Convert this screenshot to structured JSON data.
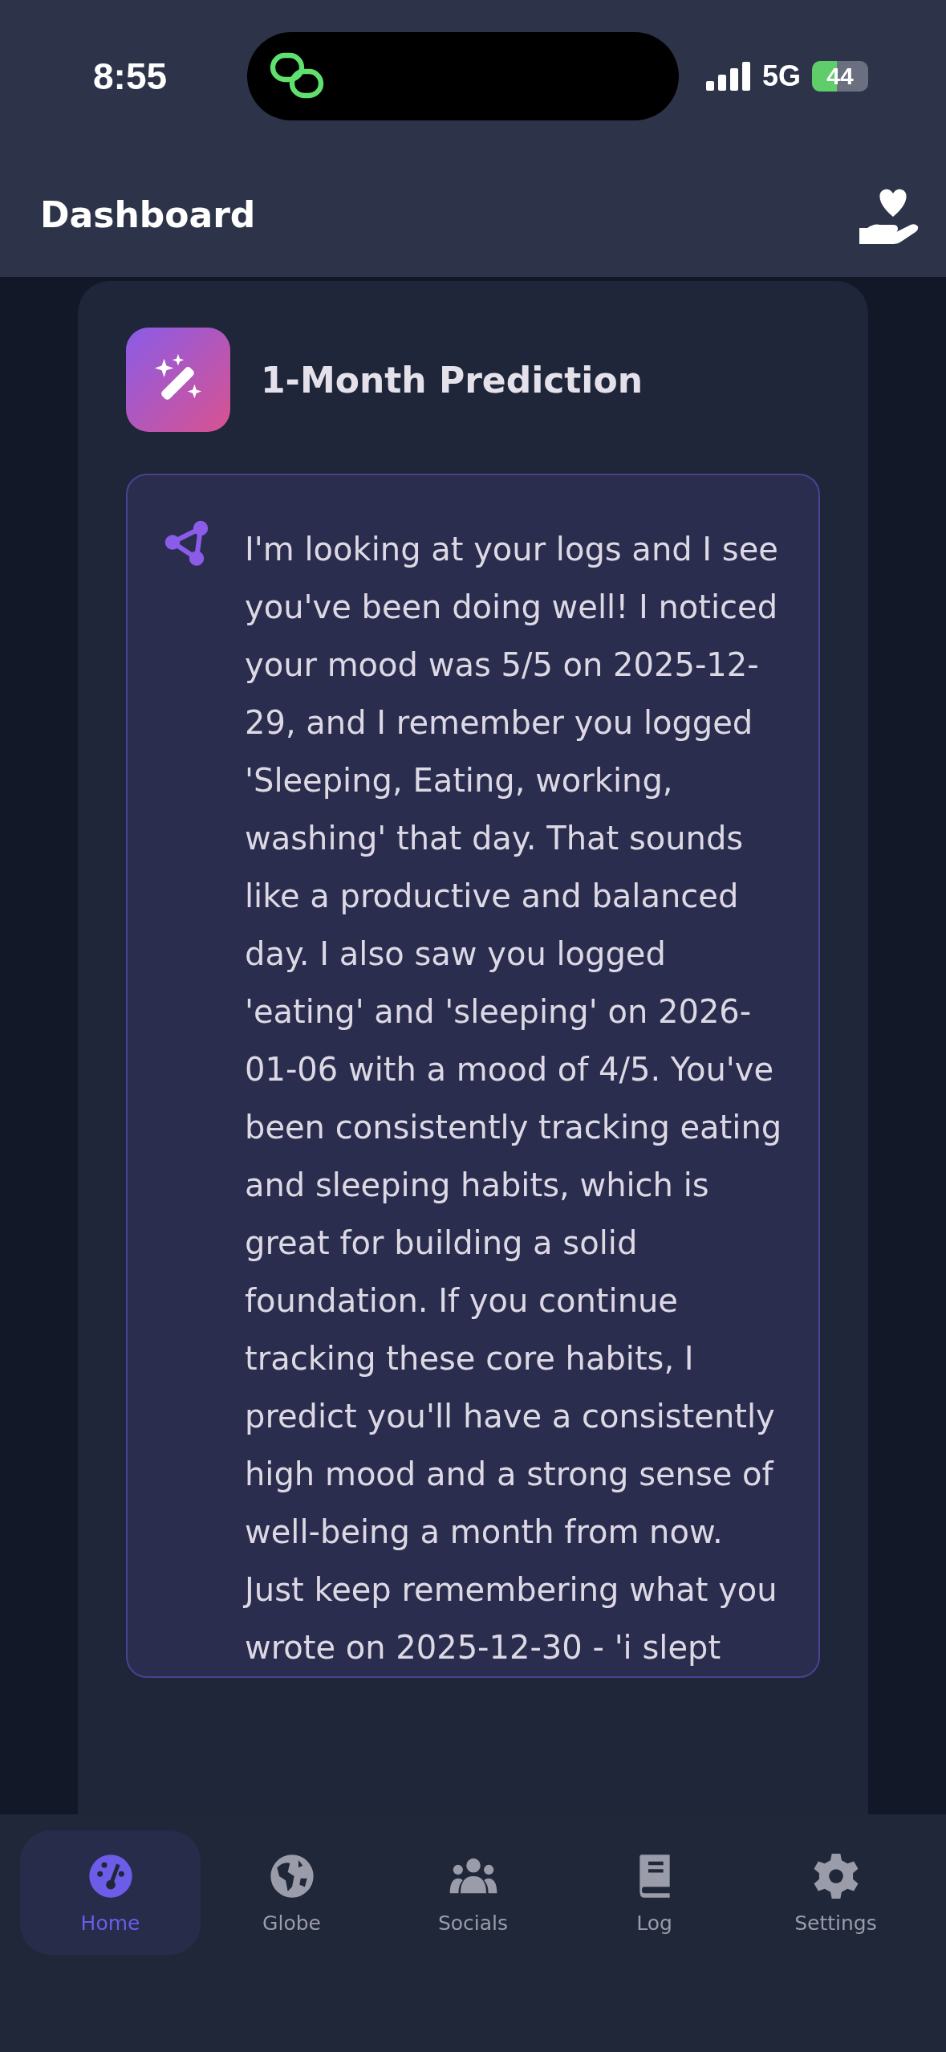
{
  "status_bar": {
    "time": "8:55",
    "network": "5G",
    "battery": "44"
  },
  "header": {
    "title": "Dashboard"
  },
  "card": {
    "title": "1-Month Prediction",
    "message": "I'm looking at your logs and I see you've been doing well! I noticed your mood was 5/5 on 2025-12-29, and I remember you logged 'Sleeping, Eating, working, washing' that day. That sounds like a productive and balanced day. I also saw you logged 'eating' and 'sleeping' on 2026-01-06 with a mood of 4/5. You've been consistently tracking eating and sleeping habits, which is great for building a solid foundation. If you continue tracking these core habits, I predict you'll have a consistently high mood and a strong sense of well-being a month from now. Just keep remembering what you wrote on 2025-12-30 - 'i slept"
  },
  "tabs": [
    {
      "label": "Home",
      "kind": "home",
      "selected": true
    },
    {
      "label": "Globe",
      "kind": "globe",
      "selected": false
    },
    {
      "label": "Socials",
      "kind": "socials",
      "selected": false
    },
    {
      "label": "Log",
      "kind": "log",
      "selected": false
    },
    {
      "label": "Settings",
      "kind": "settings",
      "selected": false
    }
  ]
}
